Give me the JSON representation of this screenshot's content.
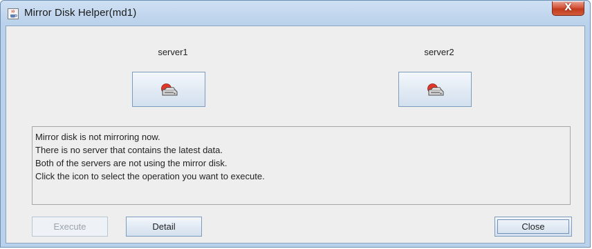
{
  "window": {
    "title": "Mirror Disk Helper(md1)",
    "close_glyph": "X",
    "app_icon": "java-cup-icon"
  },
  "servers": [
    {
      "name": "server1",
      "icon": "server-disk-icon"
    },
    {
      "name": "server2",
      "icon": "server-disk-icon"
    }
  ],
  "message": {
    "lines": [
      "Mirror disk is not mirroring now.",
      "There is no server that contains the latest data.",
      "Both of the servers are not using the mirror disk.",
      "Click the icon to select the operation you want to execute."
    ]
  },
  "buttons": {
    "execute_label": "Execute",
    "execute_enabled": false,
    "detail_label": "Detail",
    "close_label": "Close"
  },
  "colors": {
    "disk_red": "#e0392c",
    "disk_gray": "#8c8c8c",
    "button_border": "#7d9bbd",
    "titlebar": "#bcd3ec"
  }
}
